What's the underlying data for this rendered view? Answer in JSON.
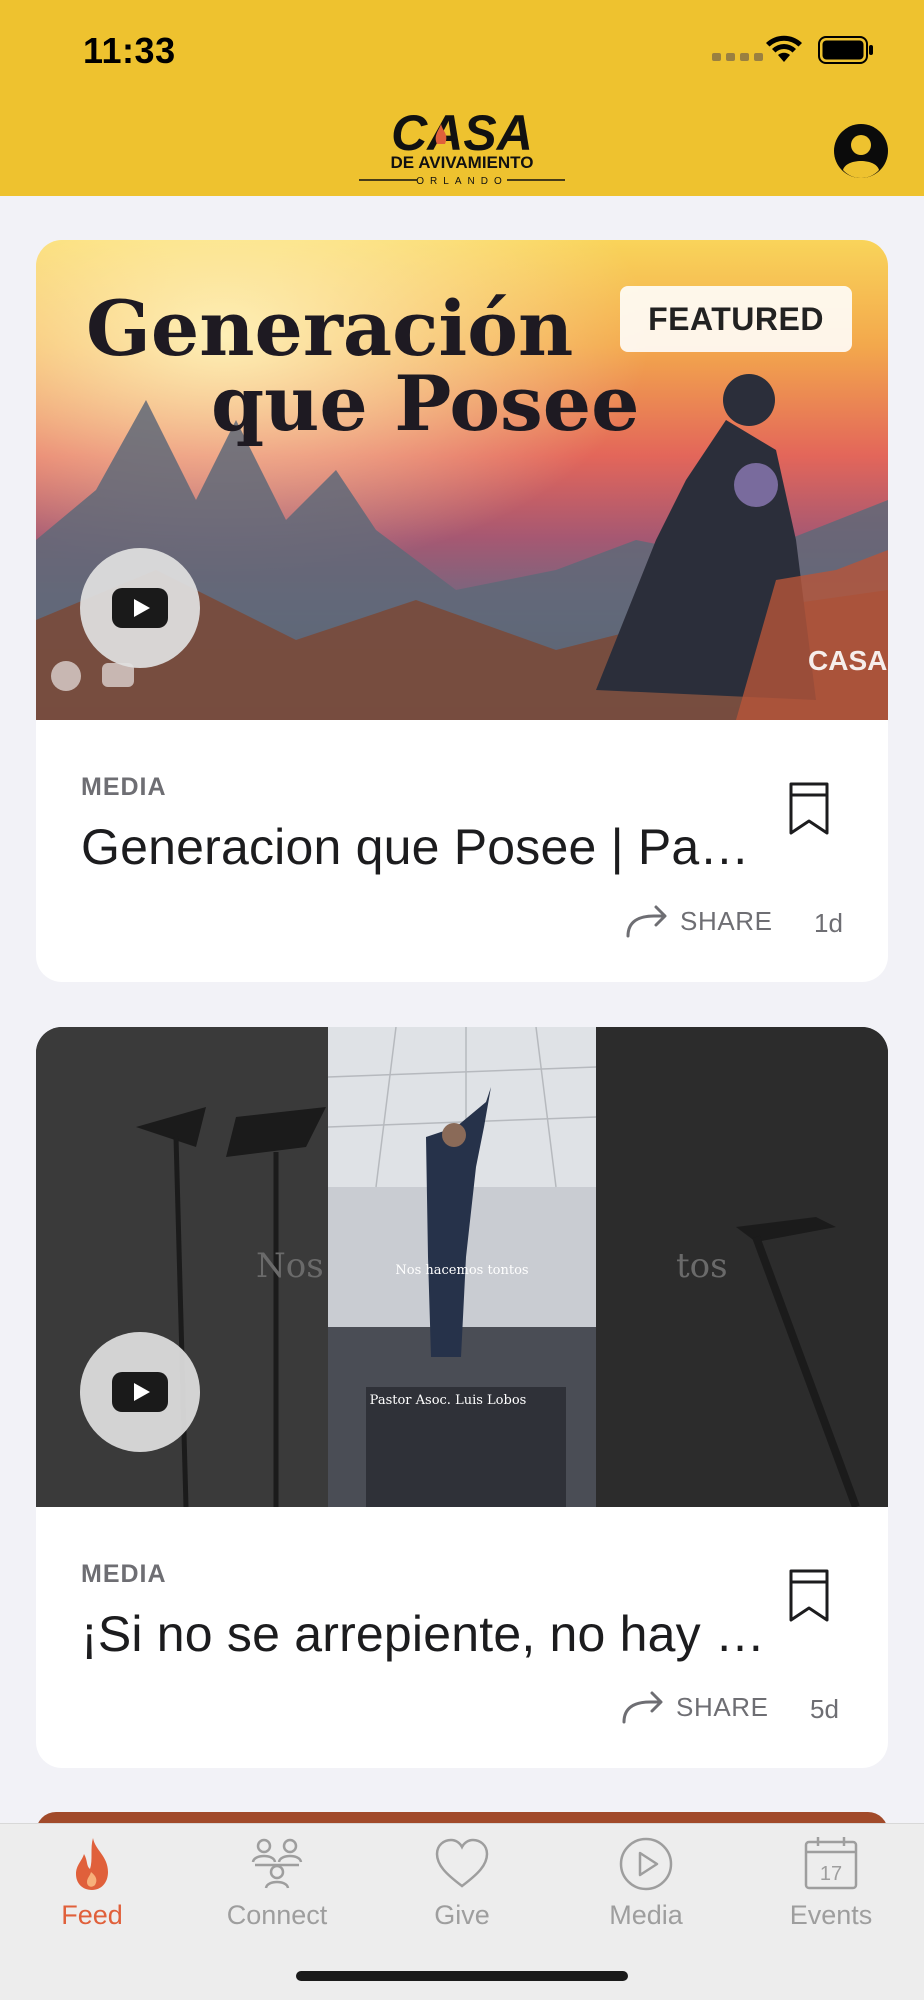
{
  "status_bar": {
    "time": "11:33"
  },
  "header": {
    "logo_line1": "CASA",
    "logo_line2": "DE AVIVAMIENTO",
    "logo_line3": "ORLANDO"
  },
  "feed": [
    {
      "badge": "FEATURED",
      "artwork_title_line1": "Generación",
      "artwork_title_line2": "que Posee",
      "category": "MEDIA",
      "title": "Generacion que Posee | Pastor Asoc. Luis Lobos",
      "share_label": "SHARE",
      "age": "1d"
    },
    {
      "artwork_caption_center": "Nos hacemos tontos",
      "artwork_caption_left": "Nos",
      "artwork_caption_right": "tos",
      "artwork_credit": "Pastor Asoc. Luis Lobos",
      "category": "MEDIA",
      "title": "¡Si no se arrepiente, no hay salvación!",
      "share_label": "SHARE",
      "age": "5d"
    }
  ],
  "tabs": [
    {
      "label": "Feed",
      "icon": "flame-icon",
      "active": true
    },
    {
      "label": "Connect",
      "icon": "people-icon",
      "active": false
    },
    {
      "label": "Give",
      "icon": "heart-icon",
      "active": false
    },
    {
      "label": "Media",
      "icon": "play-circle-icon",
      "active": false
    },
    {
      "label": "Events",
      "icon": "calendar-icon",
      "active": false
    }
  ],
  "events_icon_day": "17",
  "colors": {
    "header": "#eec22f",
    "accent": "#e0603b",
    "tab_inactive": "#9e9e9e"
  }
}
